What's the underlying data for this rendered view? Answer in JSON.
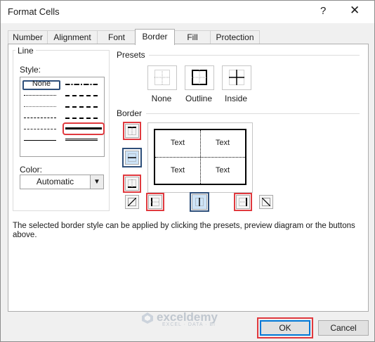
{
  "title": "Format Cells",
  "help_glyph": "?",
  "close_glyph": "✕",
  "tabs": [
    "Number",
    "Alignment",
    "Font",
    "Border",
    "Fill",
    "Protection"
  ],
  "active_tab": "Border",
  "line": {
    "group_label": "Line",
    "style_label": "Style:",
    "none_label": "None",
    "color_label": "Color:",
    "color_value": "Automatic"
  },
  "presets": {
    "group_label": "Presets",
    "items": [
      "None",
      "Outline",
      "Inside"
    ]
  },
  "border": {
    "group_label": "Border",
    "preview_texts": [
      "Text",
      "Text",
      "Text",
      "Text"
    ]
  },
  "info_text": "The selected border style can be applied by clicking the presets, preview diagram or the buttons above.",
  "buttons": {
    "ok": "OK",
    "cancel": "Cancel"
  },
  "watermark": {
    "name": "exceldemy",
    "sub": "EXCEL · DATA · BI"
  },
  "colors": {
    "highlight_red": "#e0393e",
    "highlight_blue": "#2e4f7a",
    "ok_border": "#0078d7"
  }
}
